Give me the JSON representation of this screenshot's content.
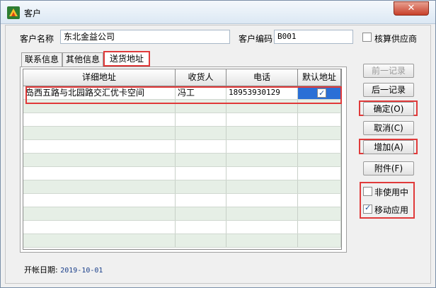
{
  "window": {
    "title": "客户",
    "close_label": "✕"
  },
  "form": {
    "customer_name_label": "客户名称",
    "customer_name_value": "东北金益公司",
    "customer_code_label": "客户编码",
    "customer_code_value": "B001",
    "supplier_check_label": "核算供应商",
    "supplier_checked": false
  },
  "tabs": [
    {
      "label": "联系信息",
      "active": false
    },
    {
      "label": "其他信息",
      "active": false
    },
    {
      "label": "送货地址",
      "active": true
    }
  ],
  "grid": {
    "columns": [
      "详细地址",
      "收货人",
      "电话",
      "默认地址"
    ],
    "rows": [
      {
        "address": "岛西五路与北园路交汇优卡空间",
        "receiver": "冯工",
        "phone": "18953930129",
        "default": true
      }
    ],
    "empty_row_count": 11
  },
  "buttons": {
    "prev_record": "前一记录",
    "next_record": "后一记录",
    "confirm": "确定(O)",
    "cancel": "取消(C)",
    "add": "增加(A)",
    "attachment": "附件(F)"
  },
  "options": {
    "inactive_label": "非使用中",
    "inactive_checked": false,
    "mobile_label": "移动应用",
    "mobile_checked": true
  },
  "footer": {
    "open_date_label": "开帐日期:",
    "open_date_value": "2019-10-01"
  },
  "colors": {
    "highlight": "#e03a3a",
    "selection": "#2a6fd6",
    "alt_row": "#e6efe6"
  }
}
